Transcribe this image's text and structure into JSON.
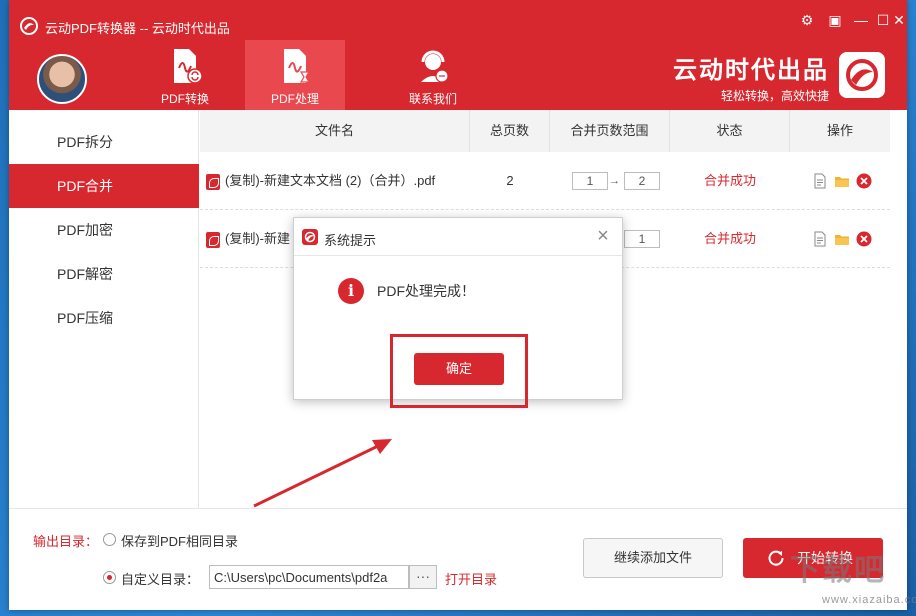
{
  "window": {
    "title": "云动PDF转换器 -- 云动时代出品",
    "controls": [
      "settings-icon",
      "skin-icon",
      "minimize-icon",
      "maximize-icon",
      "close-icon"
    ]
  },
  "nav": {
    "tabs": [
      {
        "label": "PDF转换",
        "active": false
      },
      {
        "label": "PDF处理",
        "active": true
      },
      {
        "label": "联系我们",
        "active": false
      }
    ]
  },
  "brand": {
    "name": "云动时代出品",
    "slogan": "轻松转换，高效快捷"
  },
  "sidebar": {
    "items": [
      {
        "label": "PDF拆分",
        "active": false
      },
      {
        "label": "PDF合并",
        "active": true
      },
      {
        "label": "PDF加密",
        "active": false
      },
      {
        "label": "PDF解密",
        "active": false
      },
      {
        "label": "PDF压缩",
        "active": false
      }
    ]
  },
  "table": {
    "headers": [
      "文件名",
      "总页数",
      "合并页数范围",
      "状态",
      "操作"
    ],
    "rows": [
      {
        "name": "(复制)-新建文本文档 (2)（合并）.pdf",
        "pages": "2",
        "from": "1",
        "to": "2",
        "status": "合并成功"
      },
      {
        "name": "(复制)-新建",
        "pages": "",
        "from": "",
        "to": "1",
        "status": "合并成功"
      }
    ]
  },
  "bottom": {
    "output_label": "输出目录：",
    "option_same": "保存到PDF相同目录",
    "option_custom": "自定义目录：",
    "path_value": "C:\\Users\\pc\\Documents\\pdf2a",
    "browse": "···",
    "open_dir": "打开目录",
    "add_files": "继续添加文件",
    "start": "开始转换"
  },
  "dialog": {
    "title": "系统提示",
    "message": "PDF处理完成！",
    "ok": "确定"
  },
  "watermark": {
    "text": "下载吧",
    "sub": "www.xiazaiba.com"
  },
  "colors": {
    "accent": "#d7282f",
    "desktop": "#2b86d6"
  }
}
